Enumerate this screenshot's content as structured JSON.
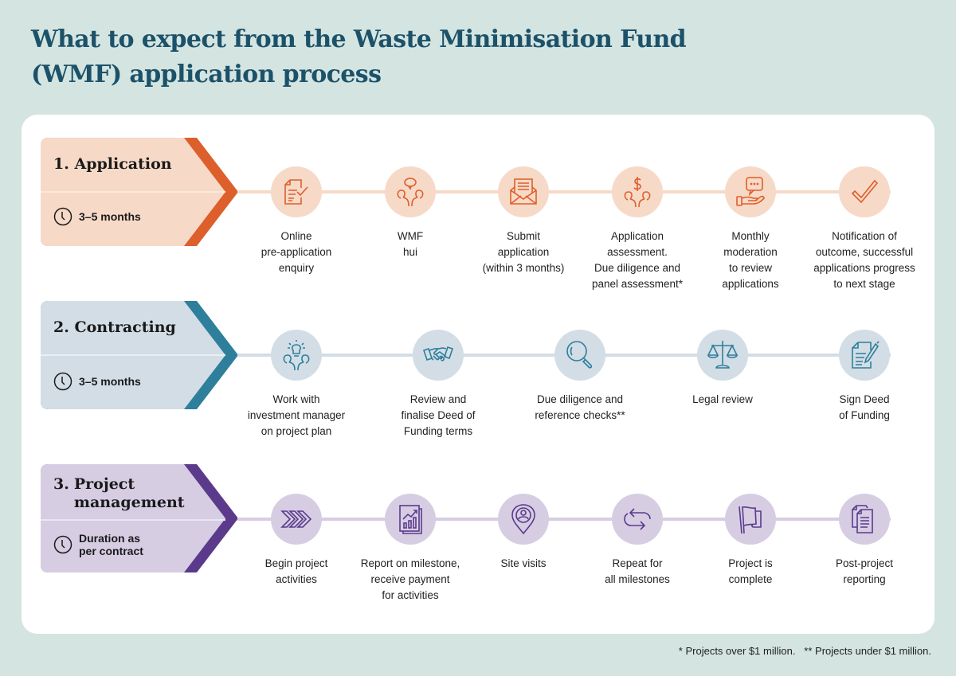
{
  "title": "What to expect from the Waste Minimisation Fund (WMF) application process",
  "colors": {
    "background": "#d4e4e1",
    "title": "#1c5269",
    "application": {
      "fill": "#f7d9c7",
      "accent": "#dd5f2b",
      "track": "#f7d9c7"
    },
    "contracting": {
      "fill": "#d3dde6",
      "accent": "#2e7f9c",
      "track": "#d3dde6"
    },
    "project": {
      "fill": "#d6cde3",
      "accent": "#5b3a8c",
      "track": "#d6cde3"
    }
  },
  "stages": [
    {
      "id": "application",
      "number": "1.",
      "name": "Application",
      "duration": "3–5 months",
      "steps": [
        {
          "icon": "document-check-icon",
          "label": "Online\npre-application\nenquiry"
        },
        {
          "icon": "people-discussion-icon",
          "label": "WMF\nhui"
        },
        {
          "icon": "envelope-letter-icon",
          "label": "Submit\napplication\n(within 3 months)"
        },
        {
          "icon": "people-dollar-icon",
          "label": "Application\nassessment.\nDue diligence and\npanel assessment*"
        },
        {
          "icon": "hand-speech-bubble-icon",
          "label": "Monthly\nmoderation\nto review\napplications"
        },
        {
          "icon": "checkmark-icon",
          "label": "Notification of\noutcome, successful\napplications progress\nto next stage"
        }
      ]
    },
    {
      "id": "contracting",
      "number": "2.",
      "name": "Contracting",
      "duration": "3–5 months",
      "steps": [
        {
          "icon": "people-lightbulb-icon",
          "label": "Work with\ninvestment manager\non project plan"
        },
        {
          "icon": "handshake-icon",
          "label": "Review and\nfinalise Deed of\nFunding terms"
        },
        {
          "icon": "magnifier-icon",
          "label": "Due diligence and\nreference checks**"
        },
        {
          "icon": "scales-icon",
          "label": "Legal review"
        },
        {
          "icon": "document-pen-icon",
          "label": "Sign Deed\nof Funding"
        }
      ]
    },
    {
      "id": "project",
      "number": "3.",
      "name": "Project\nmanagement",
      "duration": "Duration as\nper contract",
      "steps": [
        {
          "icon": "chevrons-right-icon",
          "label": "Begin project\nactivities"
        },
        {
          "icon": "report-chart-icon",
          "label": "Report on milestone,\nreceive payment\nfor activities"
        },
        {
          "icon": "location-person-icon",
          "label": "Site visits"
        },
        {
          "icon": "repeat-arrows-icon",
          "label": "Repeat for\nall milestones"
        },
        {
          "icon": "flag-icon",
          "label": "Project is\ncomplete"
        },
        {
          "icon": "documents-icon",
          "label": "Post-project\nreporting"
        }
      ]
    }
  ],
  "footnote": "* Projects over $1 million.   ** Projects under $1 million."
}
